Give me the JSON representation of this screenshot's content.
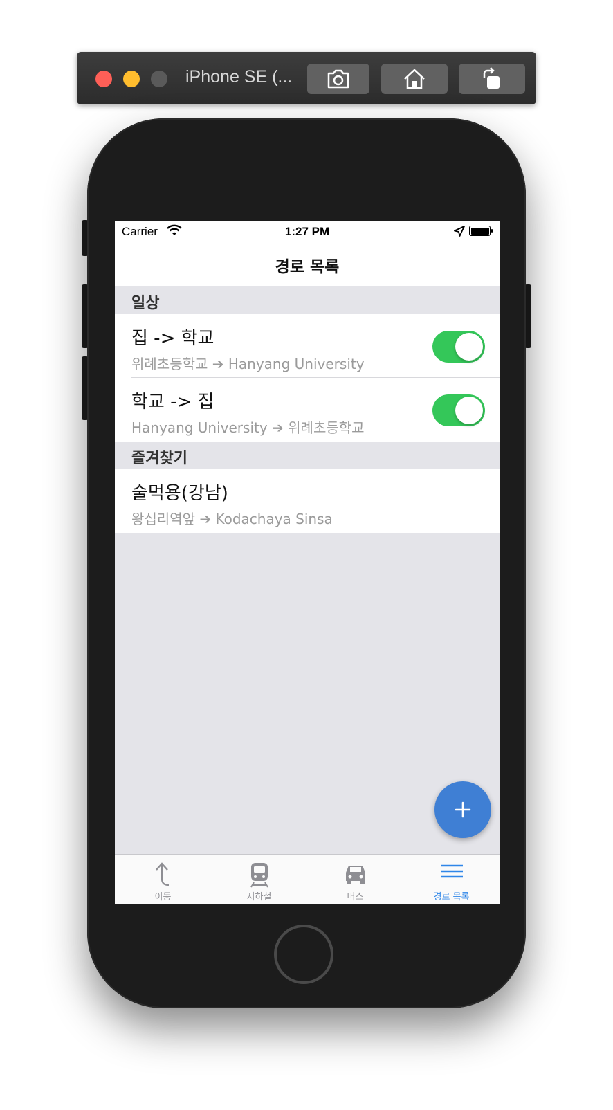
{
  "simulator": {
    "title": "iPhone SE (...",
    "buttons": [
      "camera-icon",
      "home-icon",
      "rotate-icon"
    ]
  },
  "status_bar": {
    "carrier": "Carrier",
    "time": "1:27 PM"
  },
  "nav": {
    "title": "경로 목록"
  },
  "sections": [
    {
      "header": "일상",
      "rows": [
        {
          "title": "집 -> 학교",
          "subtitle": "위례초등학교 ➔ Hanyang University",
          "toggle_on": true
        },
        {
          "title": "학교 -> 집",
          "subtitle": "Hanyang University ➔ 위례초등학교",
          "toggle_on": true
        }
      ]
    },
    {
      "header": "즐겨찾기",
      "rows": [
        {
          "title": "술먹용(강남)",
          "subtitle": "왕십리역앞 ➔ Kodachaya Sinsa"
        }
      ]
    }
  ],
  "fab": {
    "label": "+"
  },
  "tabs": [
    {
      "label": "이동",
      "icon": "turn-up-arrow-icon",
      "active": false
    },
    {
      "label": "지하철",
      "icon": "subway-icon",
      "active": false
    },
    {
      "label": "버스",
      "icon": "car-icon",
      "active": false
    },
    {
      "label": "경로 목록",
      "icon": "list-icon",
      "active": true
    }
  ],
  "colors": {
    "toggle_on": "#34c759",
    "fab": "#3f7fd4",
    "tab_active": "#2f86e8",
    "tab_inactive": "#8e8e93"
  }
}
